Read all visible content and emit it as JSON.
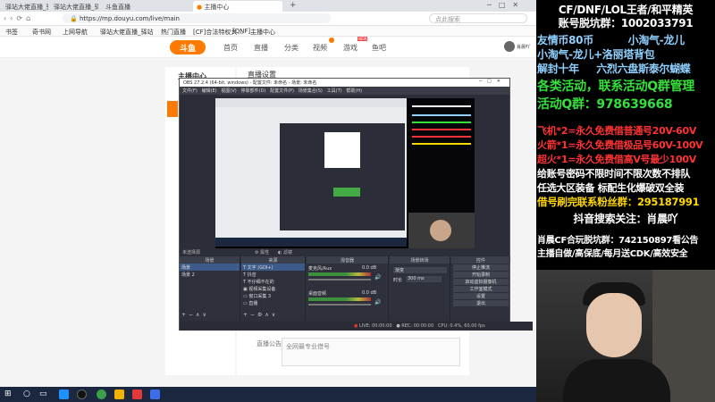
{
  "browser": {
    "tabs": [
      "驿站大佬直播_驿站大佬直播网...",
      "驿站大佬直播_驿站大佬直播网...",
      "斗鱼直播",
      "主播中心"
    ],
    "url": "https://mp.douyu.com/live/main",
    "bookmarks": [
      "书签",
      "奇书网",
      "上网导航",
      "驿站大佬直播_驿站",
      "热门直播",
      "[CF]合法特权大...",
      "[DNF]...",
      "主播中心"
    ],
    "search_placeholder": "点此搜索"
  },
  "site": {
    "logo": "斗鱼",
    "nav": [
      "首页",
      "直播",
      "分类",
      "视频",
      "游戏",
      "鱼吧"
    ],
    "badge_new": "NEW",
    "user": "肖晨吖"
  },
  "page": {
    "sidebar_title": "主播中心",
    "content_title": "直播设置",
    "notice_label": "直播公告：",
    "notice_placeholder": "全网最专业借号"
  },
  "obs": {
    "title": "OBS 27.2.4 (64-bit, windows) - 配置文件: 未命名 - 场景: 未命名",
    "menu": [
      "文件(F)",
      "编辑(E)",
      "视图(V)",
      "停靠部件(D)",
      "配置文件(P)",
      "场景集合(S)",
      "工具(T)",
      "帮助(H)"
    ],
    "no_source": "未选择源",
    "props": "属性",
    "filters": "滤镜",
    "scenes_header": "场景",
    "scenes": [
      "场景",
      "场景 2"
    ],
    "sources_header": "来源",
    "sources": [
      "文字 (GDI+)",
      "抖音",
      "不仔细不在的",
      "视频采集设备",
      "窗口采集 3",
      "直播"
    ],
    "mixer_header": "混音器",
    "mixer": [
      {
        "name": "麦克风/Aux",
        "db": "0.0 dB"
      },
      {
        "name": "桌面音频",
        "db": "0.0 dB"
      }
    ],
    "transitions_header": "场景转场",
    "transition_fade": "渐变",
    "duration_label": "时长",
    "duration": "300 ms",
    "controls_header": "控件",
    "controls": [
      "停止推流",
      "开始录制",
      "启动虚拟摄像机",
      "工作室模式",
      "设置",
      "退出"
    ],
    "status": {
      "live": "LIVE: 00:00:00",
      "rec": "REC: 00:00:00",
      "cpu": "CPU: 0.4%, 60.00 fps"
    }
  },
  "overlay": {
    "lines": [
      {
        "text": "CF/DNF/LOL王者/和平精英",
        "color": "#ffffff"
      },
      {
        "text": "账号脱坑群：1002033791",
        "color": "#ffffff"
      },
      {
        "text": "友情币80币          小淘气-龙儿",
        "color": "#8fd0ff"
      },
      {
        "text": "小淘气-龙儿+洛丽塔背包",
        "color": "#8fd0ff"
      },
      {
        "text": "解封十年     六烈六盘斯泰尔蝴蝶",
        "color": "#8fd0ff"
      },
      {
        "text": "各类活动，联系活动Q群管理",
        "color": "#34e03a"
      },
      {
        "text": "活动Q群：978639668",
        "color": "#34e03a"
      },
      {
        "text": "飞机*2=永久免费借普通号20V-60V",
        "color": "#ff3333"
      },
      {
        "text": "火箭*1=永久免费借极品号60V-100V",
        "color": "#ff3333"
      },
      {
        "text": "超火*1=永久免费借高V号最少100V",
        "color": "#ff3333"
      },
      {
        "text": "给账号密码不限时间不限次数不排队",
        "color": "#ffffff"
      },
      {
        "text": "任选大区装备 标配生化爆破双全装",
        "color": "#ffffff"
      },
      {
        "text": "借号刷完联系粉丝群：295187991",
        "color": "#ffd800"
      },
      {
        "text": "抖音搜索关注：肖晨吖",
        "color": "#ffffff"
      },
      {
        "text": "肖晨CF合玩脱坑群：742150897看公告",
        "color": "#ffffff"
      },
      {
        "text": "主播自做/高保底/每月送CDK/高效安全",
        "color": "#ffffff"
      }
    ]
  },
  "colors": {
    "douyu_orange": "#ff7a00",
    "obs_bg": "#2b2e38",
    "taskbar": "#1c2740"
  }
}
